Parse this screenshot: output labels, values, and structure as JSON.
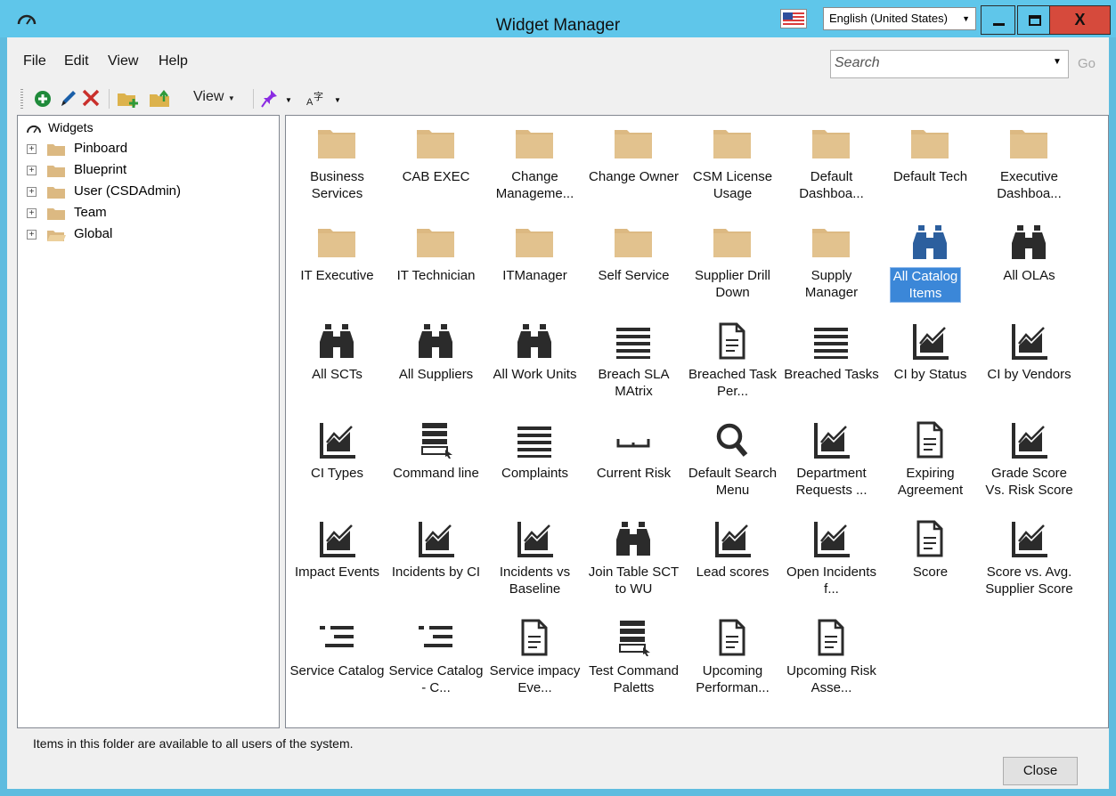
{
  "window": {
    "title": "Widget Manager",
    "language": "English (United States)",
    "close_glyph": "X",
    "titlebar_color": "#5fc6ea",
    "close_color": "#d64a3c"
  },
  "menu": {
    "items": [
      "File",
      "Edit",
      "View",
      "Help"
    ]
  },
  "search": {
    "placeholder": "Search",
    "go_label": "Go"
  },
  "toolbar": {
    "view_label": "View",
    "icons": [
      "add-icon",
      "edit-icon",
      "delete-icon",
      "new-folder-icon",
      "folder-up-icon",
      "pin-icon",
      "language-icon"
    ]
  },
  "tree": {
    "root_label": "Widgets",
    "items": [
      {
        "label": "Pinboard",
        "open": false
      },
      {
        "label": "Blueprint",
        "open": false
      },
      {
        "label": "User (CSDAdmin)",
        "open": false
      },
      {
        "label": "Team",
        "open": false
      },
      {
        "label": "Global",
        "open": true
      }
    ]
  },
  "widgets": [
    {
      "label": "Business Services",
      "icon": "folder"
    },
    {
      "label": "CAB EXEC",
      "icon": "folder"
    },
    {
      "label": "Change Manageme...",
      "icon": "folder"
    },
    {
      "label": "Change Owner",
      "icon": "folder"
    },
    {
      "label": "CSM License Usage",
      "icon": "folder"
    },
    {
      "label": "Default Dashboa...",
      "icon": "folder"
    },
    {
      "label": "Default Tech",
      "icon": "folder"
    },
    {
      "label": "Executive Dashboa...",
      "icon": "folder"
    },
    {
      "label": "IT Executive",
      "icon": "folder"
    },
    {
      "label": "IT Technician",
      "icon": "folder"
    },
    {
      "label": "ITManager",
      "icon": "folder"
    },
    {
      "label": "Self Service",
      "icon": "folder"
    },
    {
      "label": "Supplier Drill Down",
      "icon": "folder"
    },
    {
      "label": "Supply Manager",
      "icon": "folder"
    },
    {
      "label": "All Catalog Items",
      "icon": "binoculars",
      "selected": true
    },
    {
      "label": "All OLAs",
      "icon": "binoculars"
    },
    {
      "label": "All SCTs",
      "icon": "binoculars"
    },
    {
      "label": "All Suppliers",
      "icon": "binoculars"
    },
    {
      "label": "All Work Units",
      "icon": "binoculars"
    },
    {
      "label": "Breach SLA MAtrix",
      "icon": "list"
    },
    {
      "label": "Breached Task Per...",
      "icon": "document"
    },
    {
      "label": "Breached Tasks",
      "icon": "list"
    },
    {
      "label": "CI by Status",
      "icon": "chart"
    },
    {
      "label": "CI by Vendors",
      "icon": "chart"
    },
    {
      "label": "CI Types",
      "icon": "chart"
    },
    {
      "label": "Command line",
      "icon": "command"
    },
    {
      "label": "Complaints",
      "icon": "list"
    },
    {
      "label": "Current Risk",
      "icon": "ruler"
    },
    {
      "label": "Default Search Menu",
      "icon": "magnifier"
    },
    {
      "label": "Department Requests ...",
      "icon": "chart"
    },
    {
      "label": "Expiring Agreement",
      "icon": "document"
    },
    {
      "label": "Grade Score Vs. Risk Score",
      "icon": "chart"
    },
    {
      "label": "Impact Events",
      "icon": "chart"
    },
    {
      "label": "Incidents by CI",
      "icon": "chart"
    },
    {
      "label": "Incidents vs Baseline",
      "icon": "chart"
    },
    {
      "label": "Join Table SCT to WU",
      "icon": "binoculars"
    },
    {
      "label": "Lead scores",
      "icon": "chart"
    },
    {
      "label": "Open Incidents f...",
      "icon": "chart"
    },
    {
      "label": "Score",
      "icon": "document"
    },
    {
      "label": "Score vs. Avg. Supplier Score",
      "icon": "chart"
    },
    {
      "label": "Service Catalog",
      "icon": "menu-list"
    },
    {
      "label": "Service Catalog - C...",
      "icon": "menu-list"
    },
    {
      "label": "Service impacy Eve...",
      "icon": "document"
    },
    {
      "label": "Test Command Paletts",
      "icon": "command"
    },
    {
      "label": "Upcoming Performan...",
      "icon": "document"
    },
    {
      "label": "Upcoming Risk Asse...",
      "icon": "document"
    }
  ],
  "status_text": "Items in this folder are available to all users of the system.",
  "close_button_label": "Close",
  "colors": {
    "folder": "#dcb982",
    "icon_dark": "#2b2b2b",
    "icon_blue": "#2c5f9e",
    "selection": "#3b87d8"
  }
}
